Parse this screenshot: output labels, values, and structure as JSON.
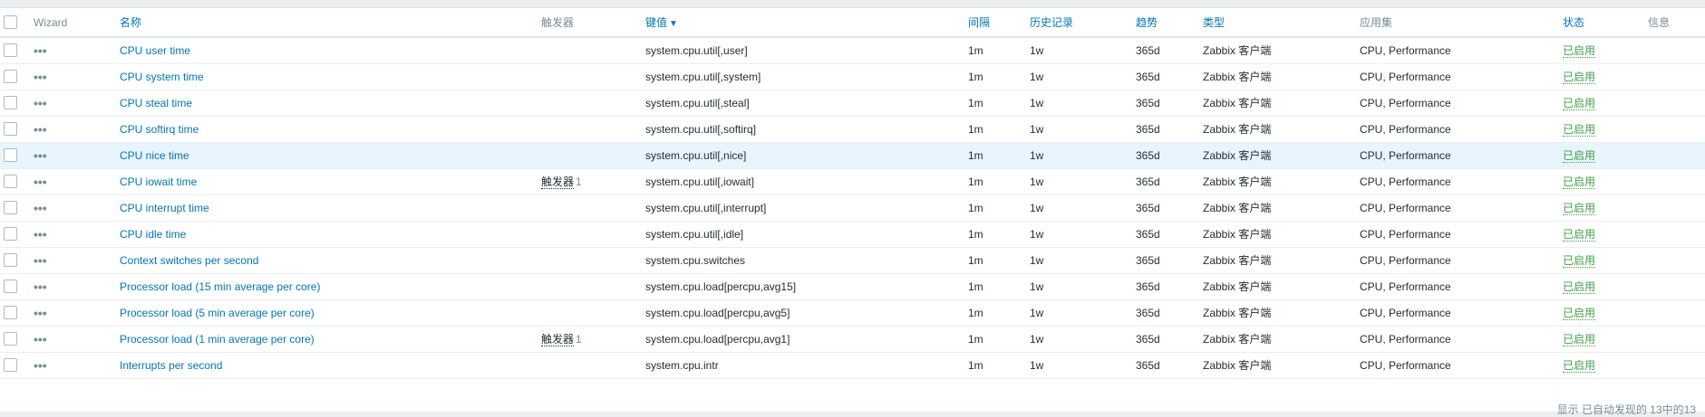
{
  "table": {
    "headers": {
      "wizard": "Wizard",
      "name": "名称",
      "triggers": "触发器",
      "key": "键值",
      "interval": "间隔",
      "history": "历史记录",
      "trends": "趋势",
      "type": "类型",
      "applications": "应用集",
      "status": "状态",
      "info": "信息"
    },
    "sort_arrow": "▼",
    "rows": [
      {
        "name": "CPU user time",
        "triggers_label": "",
        "triggers_count": "",
        "key": "system.cpu.util[,user]",
        "interval": "1m",
        "history": "1w",
        "trends": "365d",
        "type": "Zabbix 客户端",
        "applications": "CPU, Performance",
        "status": "已启用"
      },
      {
        "name": "CPU system time",
        "triggers_label": "",
        "triggers_count": "",
        "key": "system.cpu.util[,system]",
        "interval": "1m",
        "history": "1w",
        "trends": "365d",
        "type": "Zabbix 客户端",
        "applications": "CPU, Performance",
        "status": "已启用"
      },
      {
        "name": "CPU steal time",
        "triggers_label": "",
        "triggers_count": "",
        "key": "system.cpu.util[,steal]",
        "interval": "1m",
        "history": "1w",
        "trends": "365d",
        "type": "Zabbix 客户端",
        "applications": "CPU, Performance",
        "status": "已启用"
      },
      {
        "name": "CPU softirq time",
        "triggers_label": "",
        "triggers_count": "",
        "key": "system.cpu.util[,softirq]",
        "interval": "1m",
        "history": "1w",
        "trends": "365d",
        "type": "Zabbix 客户端",
        "applications": "CPU, Performance",
        "status": "已启用"
      },
      {
        "name": "CPU nice time",
        "triggers_label": "",
        "triggers_count": "",
        "key": "system.cpu.util[,nice]",
        "interval": "1m",
        "history": "1w",
        "trends": "365d",
        "type": "Zabbix 客户端",
        "applications": "CPU, Performance",
        "status": "已启用"
      },
      {
        "name": "CPU iowait time",
        "triggers_label": "触发器",
        "triggers_count": "1",
        "key": "system.cpu.util[,iowait]",
        "interval": "1m",
        "history": "1w",
        "trends": "365d",
        "type": "Zabbix 客户端",
        "applications": "CPU, Performance",
        "status": "已启用"
      },
      {
        "name": "CPU interrupt time",
        "triggers_label": "",
        "triggers_count": "",
        "key": "system.cpu.util[,interrupt]",
        "interval": "1m",
        "history": "1w",
        "trends": "365d",
        "type": "Zabbix 客户端",
        "applications": "CPU, Performance",
        "status": "已启用"
      },
      {
        "name": "CPU idle time",
        "triggers_label": "",
        "triggers_count": "",
        "key": "system.cpu.util[,idle]",
        "interval": "1m",
        "history": "1w",
        "trends": "365d",
        "type": "Zabbix 客户端",
        "applications": "CPU, Performance",
        "status": "已启用"
      },
      {
        "name": "Context switches per second",
        "triggers_label": "",
        "triggers_count": "",
        "key": "system.cpu.switches",
        "interval": "1m",
        "history": "1w",
        "trends": "365d",
        "type": "Zabbix 客户端",
        "applications": "CPU, Performance",
        "status": "已启用"
      },
      {
        "name": "Processor load (15 min average per core)",
        "triggers_label": "",
        "triggers_count": "",
        "key": "system.cpu.load[percpu,avg15]",
        "interval": "1m",
        "history": "1w",
        "trends": "365d",
        "type": "Zabbix 客户端",
        "applications": "CPU, Performance",
        "status": "已启用"
      },
      {
        "name": "Processor load (5 min average per core)",
        "triggers_label": "",
        "triggers_count": "",
        "key": "system.cpu.load[percpu,avg5]",
        "interval": "1m",
        "history": "1w",
        "trends": "365d",
        "type": "Zabbix 客户端",
        "applications": "CPU, Performance",
        "status": "已启用"
      },
      {
        "name": "Processor load (1 min average per core)",
        "triggers_label": "触发器",
        "triggers_count": "1",
        "key": "system.cpu.load[percpu,avg1]",
        "interval": "1m",
        "history": "1w",
        "trends": "365d",
        "type": "Zabbix 客户端",
        "applications": "CPU, Performance",
        "status": "已启用"
      },
      {
        "name": "Interrupts per second",
        "triggers_label": "",
        "triggers_count": "",
        "key": "system.cpu.intr",
        "interval": "1m",
        "history": "1w",
        "trends": "365d",
        "type": "Zabbix 客户端",
        "applications": "CPU, Performance",
        "status": "已启用"
      }
    ]
  },
  "footer": {
    "summary": "显示 已自动发现的 13中的13"
  },
  "colors": {
    "link": "#0275b8",
    "status_enabled": "#429e47",
    "row_hover": "#e8f5ff"
  }
}
